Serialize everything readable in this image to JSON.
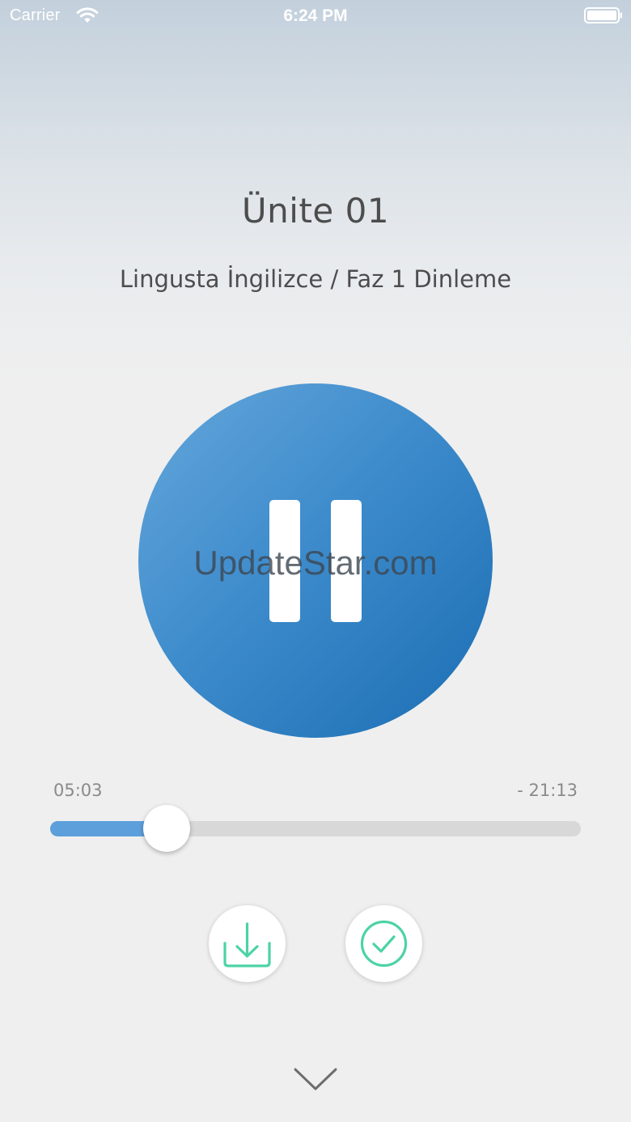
{
  "status_bar": {
    "carrier": "Carrier",
    "time": "6:24 PM",
    "icons": [
      "wifi-icon",
      "battery-icon"
    ]
  },
  "player": {
    "title": "Ünite 01",
    "subtitle": "Lingusta İngilizce / Faz 1 Dinleme",
    "state_icon": "pause-icon",
    "accent_color": "#3e8ccc",
    "elapsed": "05:03",
    "remaining": "- 21:13",
    "progress_fraction": 0.22
  },
  "watermark": "UpdateStar.com",
  "actions": {
    "download_icon": "download-icon",
    "done_icon": "checkmark-circle-icon",
    "icon_color": "#4cd3a5"
  },
  "collapse_icon": "chevron-down-icon"
}
